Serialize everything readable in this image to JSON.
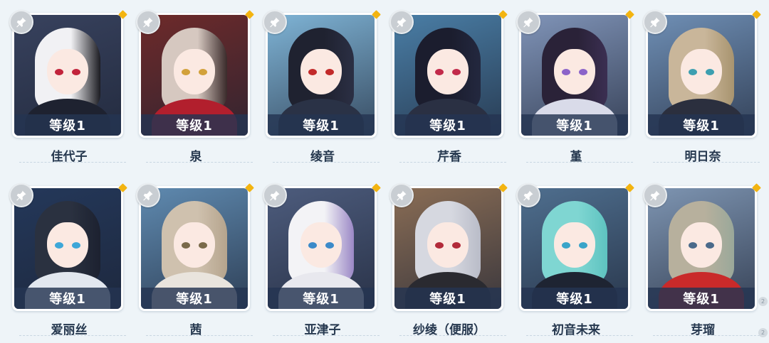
{
  "characters": [
    {
      "name": "佳代子",
      "level": "等级1",
      "bg": "#38425e",
      "hair": "#f1f1f4",
      "hair2": "#1c1c22",
      "body": "#1e2230",
      "eye": "#c2233b"
    },
    {
      "name": "泉",
      "level": "等级1",
      "bg": "#6e2a2a",
      "hair": "#d6c8c0",
      "hair2": "#3a2a2a",
      "body": "#b21f2d",
      "eye": "#d2a13a"
    },
    {
      "name": "绫音",
      "level": "等级1",
      "bg": "#7fb4d6",
      "hair": "#1f2230",
      "hair2": "#2b2f44",
      "body": "#2a3246",
      "eye": "#c22a2a"
    },
    {
      "name": "芹香",
      "level": "等级1",
      "bg": "#4a7ea6",
      "hair": "#1b1d2e",
      "hair2": "#23283f",
      "body": "#2a3043",
      "eye": "#c22a4a"
    },
    {
      "name": "堇",
      "level": "等级1",
      "bg": "#8094b8",
      "hair": "#2a2238",
      "hair2": "#3b2f52",
      "body": "#d9dbe9",
      "eye": "#8b63c9"
    },
    {
      "name": "明日奈",
      "level": "等级1",
      "bg": "#6f8fb5",
      "hair": "#c9b69a",
      "hair2": "#a8946f",
      "body": "#2b2f3e",
      "eye": "#3d9fb0"
    },
    {
      "name": "爱丽丝",
      "level": "等级1",
      "bg": "#24385a",
      "hair": "#2a3140",
      "hair2": "#1c2130",
      "body": "#e2e7ef",
      "eye": "#3ea7d8"
    },
    {
      "name": "茜",
      "level": "等级1",
      "bg": "#5f8ab0",
      "hair": "#cfc1ae",
      "hair2": "#b5a48d",
      "body": "#e9e4dd",
      "eye": "#7a6a4a"
    },
    {
      "name": "亚津子",
      "level": "等级1",
      "bg": "#4d5c7d",
      "hair": "#f3f3f6",
      "hair2": "#9b88c6",
      "body": "#e8e8ee",
      "eye": "#3b8ac9"
    },
    {
      "name": "纱绫（便服）",
      "level": "等级1",
      "bg": "#8a6d55",
      "hair": "#d6d8e0",
      "hair2": "#b9bcc8",
      "body": "#2a2a30",
      "eye": "#b22a3a"
    },
    {
      "name": "初音未来",
      "level": "等级1",
      "bg": "#4f6f8f",
      "hair": "#7fd6d2",
      "hair2": "#5ec3c0",
      "body": "#1e2432",
      "eye": "#3aa4c9"
    },
    {
      "name": "芽瑠",
      "level": "等级1",
      "bg": "#7e95b2",
      "hair": "#b7b09d",
      "hair2": "#9aa89a",
      "body": "#c92a2a",
      "eye": "#4a6a8a"
    }
  ],
  "theme": {
    "badge": "#f3b410",
    "level_bar": "#253452"
  },
  "scroll_indicators": [
    "2",
    "2"
  ]
}
